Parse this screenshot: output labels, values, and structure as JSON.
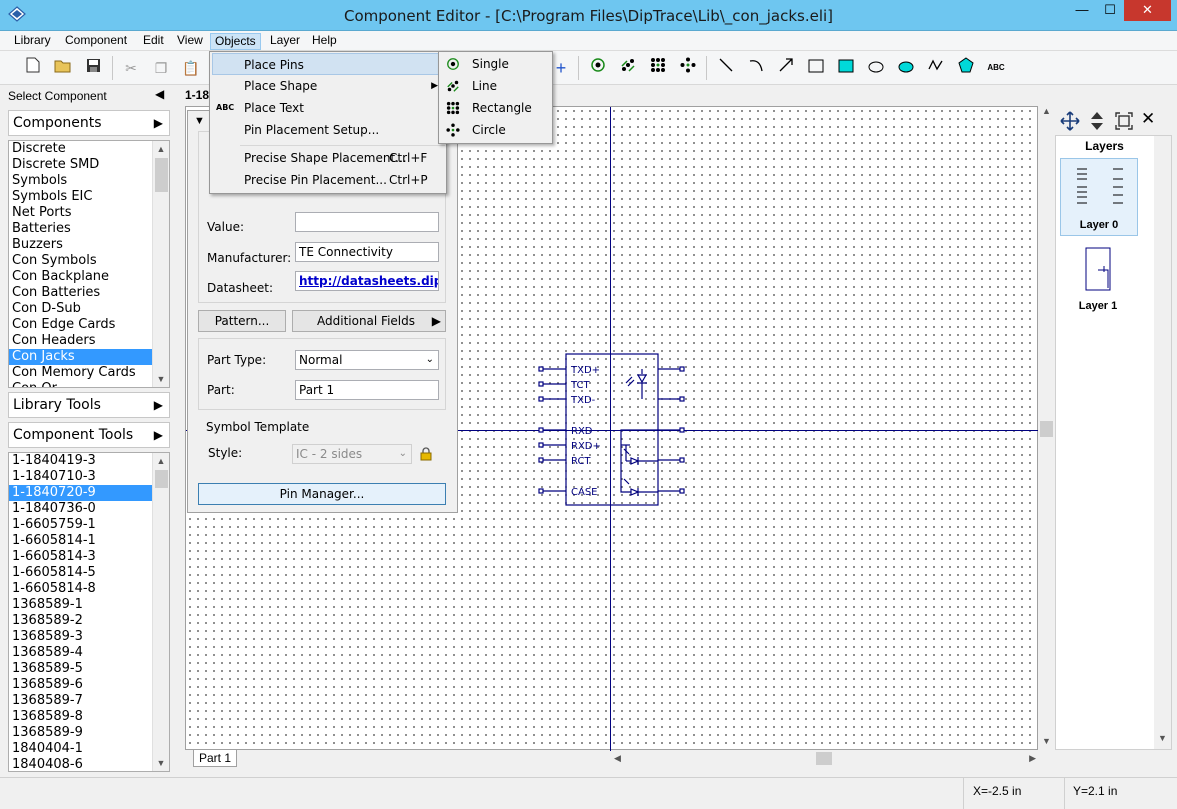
{
  "window": {
    "title": "Component Editor - [C:\\Program Files\\DipTrace\\Lib\\_con_jacks.eli]",
    "minimize": "—",
    "maximize": "☐",
    "close": "✕"
  },
  "menubar": {
    "items": [
      "Library",
      "Component",
      "Edit",
      "View",
      "Objects",
      "Layer",
      "Help"
    ],
    "active": "Objects"
  },
  "objects_menu": {
    "items": [
      {
        "label": "Place Pins",
        "shortcut": ""
      },
      {
        "label": "Place Shape",
        "shortcut": ""
      },
      {
        "label": "Place Text",
        "shortcut": ""
      },
      {
        "label": "Pin Placement Setup...",
        "shortcut": ""
      },
      {
        "label": "Precise Shape Placement...",
        "shortcut": "Ctrl+F"
      },
      {
        "label": "Precise Pin Placement...",
        "shortcut": "Ctrl+P"
      }
    ],
    "text_icon": "ABC"
  },
  "pins_submenu": {
    "items": [
      "Single",
      "Line",
      "Rectangle",
      "Circle"
    ]
  },
  "toolbar": {
    "text_tool": "ABC"
  },
  "left_panel": {
    "select_component": "Select Component",
    "components_label": "Components",
    "categories": [
      "Discrete",
      "Discrete SMD",
      "Symbols",
      "Symbols EIC",
      "Net Ports",
      "Batteries",
      "Buzzers",
      "Con Symbols",
      "Con Backplane",
      "Con Batteries",
      "Con D-Sub",
      "Con Edge Cards",
      "Con Headers",
      "Con Jacks",
      "Con Memory Cards",
      "Con Or..."
    ],
    "selected_category": "Con Jacks",
    "library_tools": "Library Tools",
    "component_tools": "Component Tools",
    "parts": [
      "1-1840419-3",
      "1-1840710-3",
      "1-1840720-9",
      "1-1840736-0",
      "1-6605759-1",
      "1-6605814-1",
      "1-6605814-3",
      "1-6605814-5",
      "1-6605814-8",
      "1368589-1",
      "1368589-2",
      "1368589-3",
      "1368589-4",
      "1368589-5",
      "1368589-6",
      "1368589-7",
      "1368589-8",
      "1368589-9",
      "1840404-1",
      "1840408-6"
    ],
    "selected_part": "1-1840720-9"
  },
  "editor": {
    "header_name": "1-18",
    "tab": "Part 1"
  },
  "properties": {
    "value_label": "Value:",
    "value": "",
    "manufacturer_label": "Manufacturer:",
    "manufacturer": "TE Connectivity",
    "datasheet_label": "Datasheet:",
    "datasheet": "http://datasheets.diptrace",
    "pattern_button": "Pattern...",
    "additional_fields_button": "Additional Fields",
    "part_type_label": "Part Type:",
    "part_type": "Normal",
    "part_label": "Part:",
    "part": "Part 1",
    "symbol_template_label": "Symbol Template",
    "style_label": "Style:",
    "style": "IC - 2 sides",
    "pin_manager_button": "Pin Manager..."
  },
  "symbol": {
    "left_pins": [
      "TXD+",
      "TCT",
      "TXD-",
      "RXD",
      "RXD+",
      "RCT",
      "CASE"
    ]
  },
  "layers_panel": {
    "title": "Layers",
    "layers": [
      "Layer 0",
      "Layer 1"
    ]
  },
  "status": {
    "x": "X=-2.5 in",
    "y": "Y=2.1 in"
  },
  "colors": {
    "title_bar": "#6ec6f0",
    "selection": "#3399ff",
    "schematic": "#00007f",
    "menu_hover": "#d1e2f2"
  }
}
